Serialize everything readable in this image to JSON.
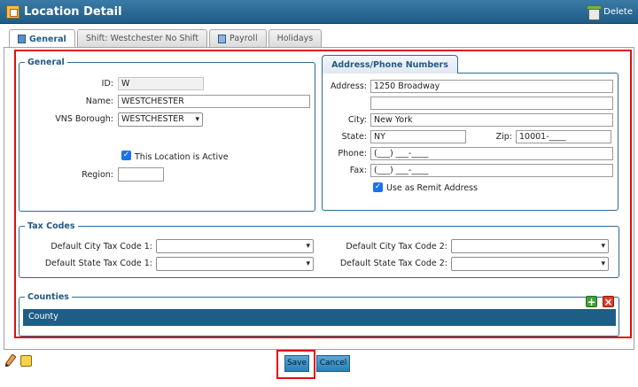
{
  "window": {
    "title": "Location Detail",
    "delete_label": "Delete"
  },
  "tabs": [
    {
      "label": "General",
      "icon": "doc-icon"
    },
    {
      "label": "Shift: Westchester No Shift"
    },
    {
      "label": "Payroll",
      "icon": "doc-icon"
    },
    {
      "label": "Holidays"
    }
  ],
  "general": {
    "legend": "General",
    "id_label": "ID:",
    "id_value": "W",
    "name_label": "Name:",
    "name_value": "WESTCHESTER",
    "borough_label": "VNS Borough:",
    "borough_value": "WESTCHESTER",
    "active_label": "This Location is Active",
    "region_label": "Region:",
    "region_value": ""
  },
  "address": {
    "tab_label": "Address/Phone Numbers",
    "address_label": "Address:",
    "address_line1": "1250 Broadway",
    "address_line2": "",
    "city_label": "City:",
    "city_value": "New York",
    "state_label": "State:",
    "state_value": "NY",
    "zip_label": "Zip:",
    "zip_value": "10001-____",
    "phone_label": "Phone:",
    "phone_value": "(___) ___-____",
    "fax_label": "Fax:",
    "fax_value": "(___) ___-____",
    "remit_label": "Use as Remit Address"
  },
  "tax": {
    "legend": "Tax Codes",
    "city1_label": "Default City Tax Code 1:",
    "state1_label": "Default State Tax Code 1:",
    "city2_label": "Default City Tax Code 2:",
    "state2_label": "Default State Tax Code 2:"
  },
  "counties": {
    "legend": "Counties",
    "column": "County"
  },
  "footer": {
    "save": "Save",
    "cancel": "Cancel"
  },
  "colors": {
    "accent": "#205c86",
    "highlight": "#e01010"
  }
}
